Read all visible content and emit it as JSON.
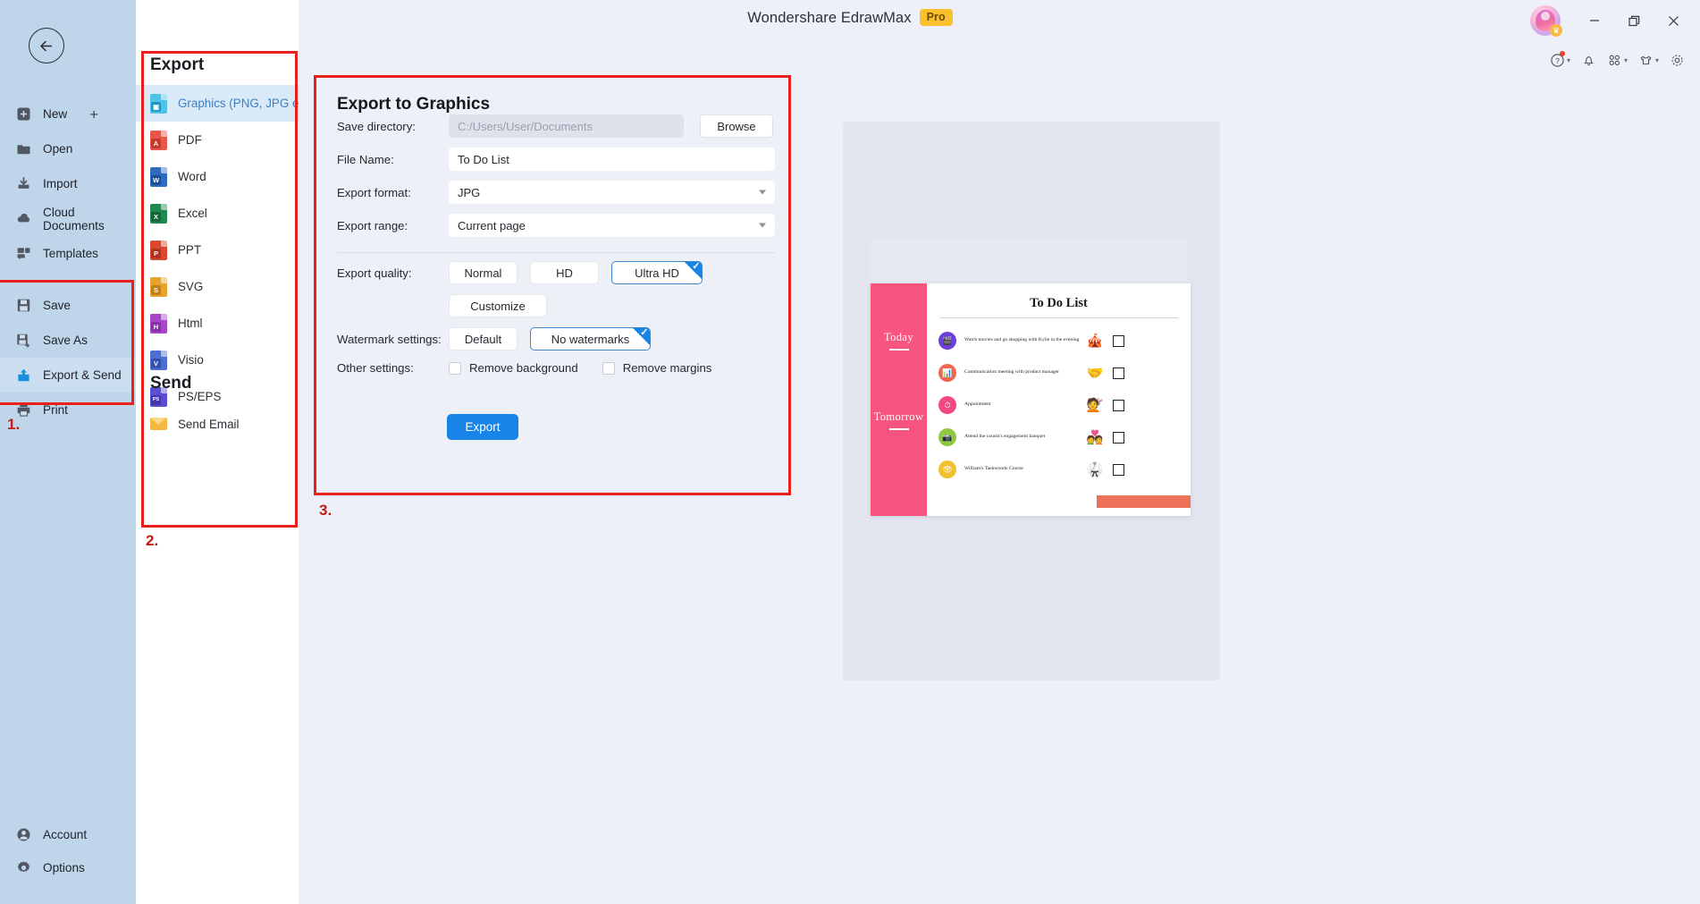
{
  "titlebar": {
    "app_title": "Wondershare EdrawMax",
    "pro_badge": "Pro",
    "minimize": "−",
    "maximize": "❐",
    "close": "✕"
  },
  "toolbar_icons": [
    {
      "name": "help-icon",
      "glyph": "?"
    },
    {
      "name": "notification-bell-icon",
      "glyph": "🔔"
    },
    {
      "name": "apps-grid-icon",
      "glyph": "▦"
    },
    {
      "name": "theme-shirt-icon",
      "glyph": "👕"
    },
    {
      "name": "settings-gear-icon",
      "glyph": "⚙"
    }
  ],
  "sidebar": {
    "back_label": "Back",
    "items": [
      {
        "label": "New",
        "icon": "new-icon",
        "has_plus": true
      },
      {
        "label": "Open",
        "icon": "folder-icon"
      },
      {
        "label": "Import",
        "icon": "import-icon"
      },
      {
        "label": "Cloud Documents",
        "icon": "cloud-icon"
      },
      {
        "label": "Templates",
        "icon": "templates-icon"
      }
    ],
    "file_items": [
      {
        "label": "Save",
        "icon": "save-icon",
        "active": false
      },
      {
        "label": "Save As",
        "icon": "save-as-icon",
        "active": false
      },
      {
        "label": "Export & Send",
        "icon": "export-send-icon",
        "active": true
      },
      {
        "label": "Print",
        "icon": "print-icon",
        "active": false
      }
    ],
    "bottom_items": [
      {
        "label": "Account",
        "icon": "account-icon"
      },
      {
        "label": "Options",
        "icon": "options-gear-icon"
      }
    ]
  },
  "export_list": {
    "title": "Export",
    "formats": [
      {
        "label": "Graphics (PNG, JPG e...",
        "color": "#4fc3e8",
        "letter": "",
        "selected": true
      },
      {
        "label": "PDF",
        "color": "#e8564a",
        "letter": "A",
        "selected": false
      },
      {
        "label": "Word",
        "color": "#2f6cc0",
        "letter": "W",
        "selected": false
      },
      {
        "label": "Excel",
        "color": "#1e8a52",
        "letter": "X",
        "selected": false
      },
      {
        "label": "PPT",
        "color": "#d9472f",
        "letter": "P",
        "selected": false
      },
      {
        "label": "SVG",
        "color": "#e8a32e",
        "letter": "S",
        "selected": false
      },
      {
        "label": "Html",
        "color": "#a846c8",
        "letter": "H",
        "selected": false
      },
      {
        "label": "Visio",
        "color": "#4c6fd1",
        "letter": "V",
        "selected": false
      },
      {
        "label": "PS/EPS",
        "color": "#5b4fd1",
        "letter": "PS",
        "selected": false
      }
    ],
    "send_title": "Send",
    "send_items": [
      {
        "label": "Send Email",
        "icon": "envelope-icon"
      }
    ]
  },
  "export_panel": {
    "title": "Export to Graphics",
    "fields": {
      "save_directory_label": "Save directory:",
      "save_directory_value": "C:/Users/User/Documents",
      "browse_label": "Browse",
      "file_name_label": "File Name:",
      "file_name_value": "To Do List",
      "export_format_label": "Export format:",
      "export_format_value": "JPG",
      "export_range_label": "Export range:",
      "export_range_value": "Current page"
    },
    "quality": {
      "label": "Export quality:",
      "options": [
        {
          "label": "Normal",
          "selected": false
        },
        {
          "label": "HD",
          "selected": false
        },
        {
          "label": "Ultra HD",
          "selected": true
        }
      ],
      "customize_label": "Customize"
    },
    "watermark": {
      "label": "Watermark settings:",
      "options": [
        {
          "label": "Default",
          "selected": false
        },
        {
          "label": "No watermarks",
          "selected": true
        }
      ]
    },
    "other": {
      "label": "Other settings:",
      "checkboxes": [
        {
          "label": "Remove background",
          "checked": false
        },
        {
          "label": "Remove margins",
          "checked": false
        }
      ]
    },
    "export_button_label": "Export"
  },
  "annotations": [
    {
      "label": "1."
    },
    {
      "label": "2."
    },
    {
      "label": "3."
    }
  ],
  "preview": {
    "title": "To Do List",
    "day_today": "Today",
    "day_tomorrow": "Tomorrow",
    "tasks": [
      {
        "text": "Watch movies and go shopping with Kylie in the evening",
        "color": "#6c3fd6",
        "glyph": "🎬",
        "emoji": "🎪",
        "checked": false
      },
      {
        "text": "Communication meeting with product manager",
        "color": "#f0674f",
        "glyph": "📊",
        "emoji": "🤝",
        "checked": false
      },
      {
        "text": "Appointment",
        "color": "#f0487f",
        "glyph": "⏱",
        "emoji": "💇",
        "checked": false
      },
      {
        "text": "Attend the cousin's engagement banquet",
        "color": "#8fc93d",
        "glyph": "📷",
        "emoji": "💑",
        "checked": false
      },
      {
        "text": "William's Taekwondo Course",
        "color": "#f0c12e",
        "glyph": "👁",
        "emoji": "🥋",
        "checked": false
      }
    ]
  },
  "colors": {
    "accent": "#1884e8",
    "sidebar_bg": "#bfd6ea",
    "annotation_red": "#e8201b",
    "pink": "#f7557f"
  }
}
